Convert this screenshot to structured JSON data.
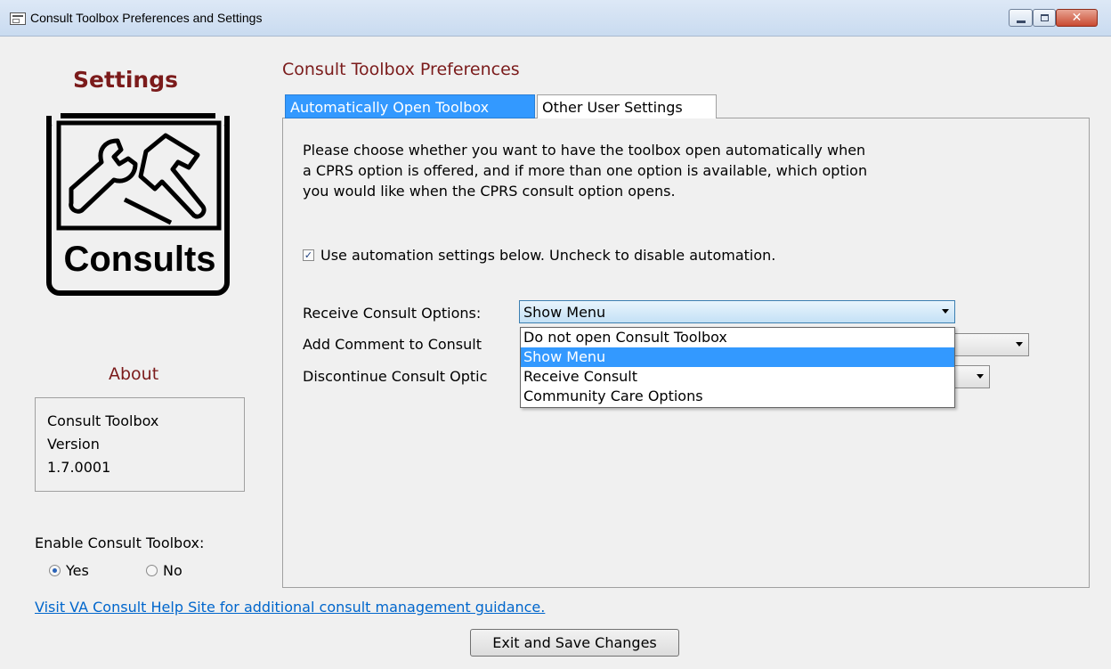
{
  "window": {
    "title": "Consult Toolbox Preferences and Settings",
    "controls": {
      "minimize": "minimize-icon",
      "maximize": "maximize-icon",
      "close": "✕"
    }
  },
  "sidebar": {
    "heading": "Settings",
    "logo_label": "Consults",
    "about_heading": "About",
    "about_lines": [
      "Consult Toolbox",
      "Version",
      "1.7.0001"
    ],
    "enable_label": "Enable Consult Toolbox:",
    "enable_options": [
      {
        "label": "Yes",
        "selected": true
      },
      {
        "label": "No",
        "selected": false
      }
    ]
  },
  "main": {
    "heading": "Consult Toolbox Preferences",
    "tabs": [
      {
        "label": "Automatically Open Toolbox",
        "active": true
      },
      {
        "label": "Other User Settings",
        "active": false
      }
    ],
    "description": [
      "Please choose whether you want to have the toolbox open automatically when",
      "a CPRS option is offered, and if more than one option is available, which option",
      "you would like when the CPRS consult option opens."
    ],
    "automation_checkbox": {
      "label": "Use automation settings below. Uncheck to disable automation.",
      "checked": true
    },
    "fields": [
      {
        "label": "Receive Consult Options:",
        "value": "Show Menu"
      },
      {
        "label": "Add Comment to Consult",
        "value": ""
      },
      {
        "label": "Discontinue Consult Optic",
        "value": ""
      }
    ],
    "dropdown_options": [
      {
        "label": "Do not open Consult Toolbox",
        "selected": false
      },
      {
        "label": "Show Menu",
        "selected": true
      },
      {
        "label": "Receive Consult",
        "selected": false
      },
      {
        "label": "Community Care Options",
        "selected": false
      }
    ]
  },
  "footer": {
    "help_link": "Visit VA Consult Help Site for additional consult management guidance.",
    "exit_button": "Exit and Save Changes"
  },
  "colors": {
    "accent": "#3399ff",
    "heading": "#7b1b1b",
    "link": "#0066cc"
  }
}
